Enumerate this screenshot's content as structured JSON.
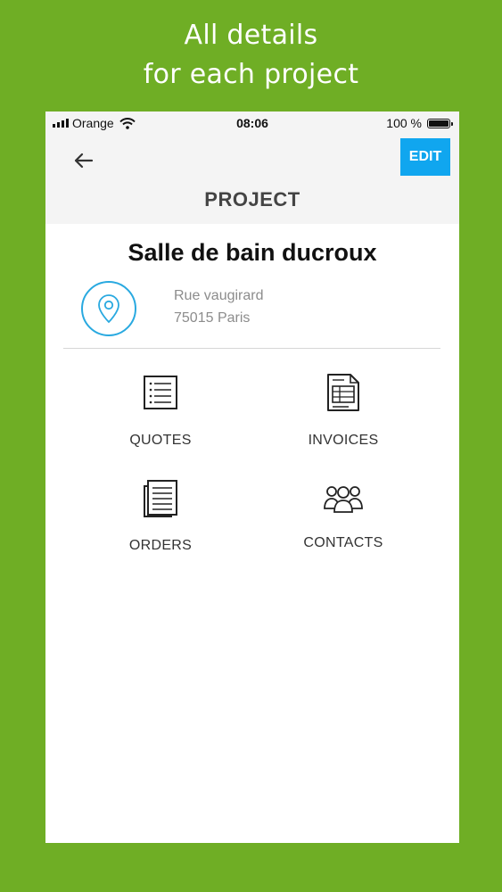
{
  "promo": {
    "line1": "All details",
    "line2": "for each project"
  },
  "status_bar": {
    "carrier": "Orange",
    "time": "08:06",
    "battery": "100 %"
  },
  "header": {
    "title": "PROJECT",
    "edit_label": "EDIT"
  },
  "project": {
    "name": "Salle de bain ducroux",
    "address_line1": "Rue vaugirard",
    "address_line2": "75015 Paris"
  },
  "menu": {
    "quotes": "QUOTES",
    "invoices": "INVOICES",
    "orders": "ORDERS",
    "contacts": "CONTACTS"
  },
  "colors": {
    "background": "#6fae25",
    "accent": "#10a6ef",
    "pin": "#29a9e0"
  }
}
